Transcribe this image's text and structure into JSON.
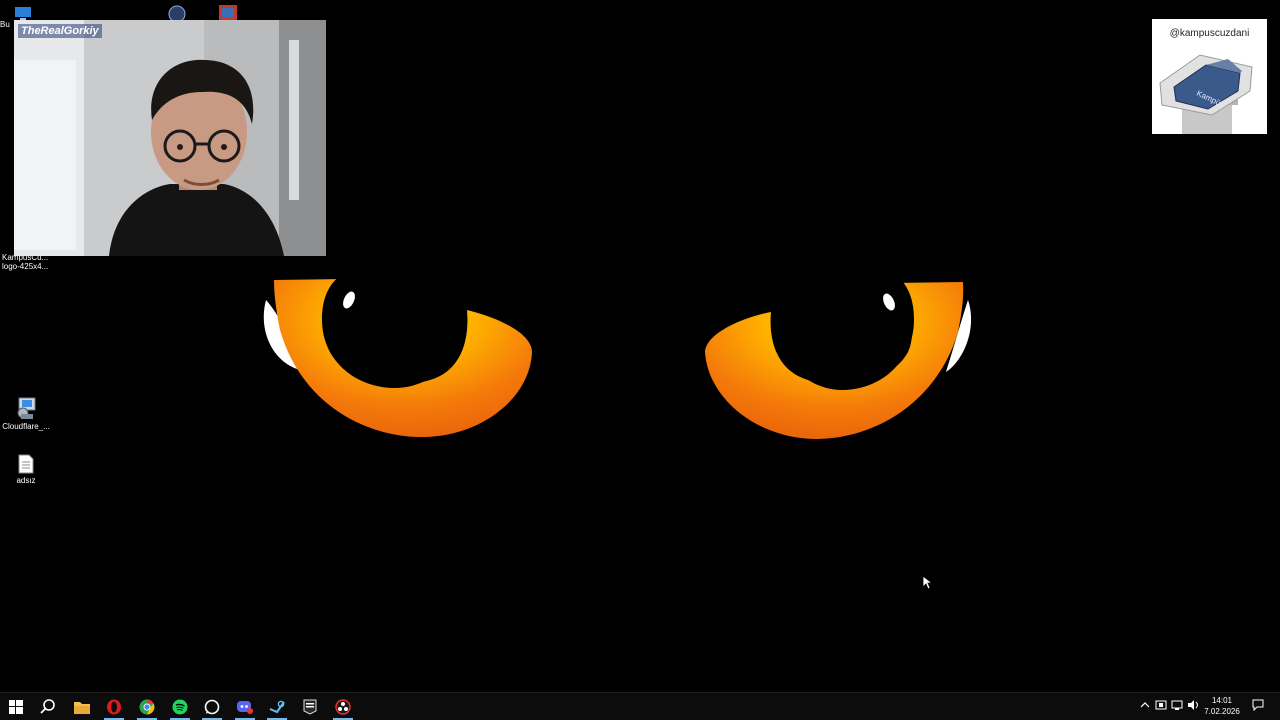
{
  "desktop": {
    "icons": [
      {
        "label": "Bu",
        "icon": "computer-icon"
      },
      {
        "label": "KampusCü...\nlogo-425x4...",
        "icon": "image-file-icon"
      },
      {
        "label": "Cloudflare_...",
        "icon": "installer-icon"
      },
      {
        "label": "adsız",
        "icon": "text-file-icon"
      }
    ],
    "wallpaper": {
      "theme": "glowing orange eyes",
      "eye_color": "#f07a0a",
      "background": "#000000"
    }
  },
  "webcam": {
    "streamer_name": "TheRealGorkiy"
  },
  "logo_card": {
    "handle": "@kampuscuzdani",
    "logo_text": "Kampüs"
  },
  "taskbar": {
    "apps": [
      {
        "name": "start",
        "icon": "windows-icon"
      },
      {
        "name": "search",
        "icon": "search-icon"
      },
      {
        "name": "file-explorer",
        "icon": "folder-icon"
      },
      {
        "name": "opera",
        "icon": "opera-icon"
      },
      {
        "name": "chrome",
        "icon": "chrome-icon"
      },
      {
        "name": "spotify",
        "icon": "spotify-icon"
      },
      {
        "name": "whatsapp",
        "icon": "whatsapp-icon"
      },
      {
        "name": "discord",
        "icon": "discord-icon"
      },
      {
        "name": "steam",
        "icon": "steam-icon"
      },
      {
        "name": "epic-games",
        "icon": "epic-games-icon"
      },
      {
        "name": "obs",
        "icon": "obs-icon"
      }
    ],
    "tray": {
      "time": "14:01",
      "date": "7.02.2026",
      "icons": [
        "chevron-up-icon",
        "tray-app-icon",
        "network-icon",
        "volume-icon",
        "notification-icon"
      ]
    }
  },
  "colors": {
    "taskbar_bg": "#0c0c0c",
    "accent": "#76b9ed"
  }
}
